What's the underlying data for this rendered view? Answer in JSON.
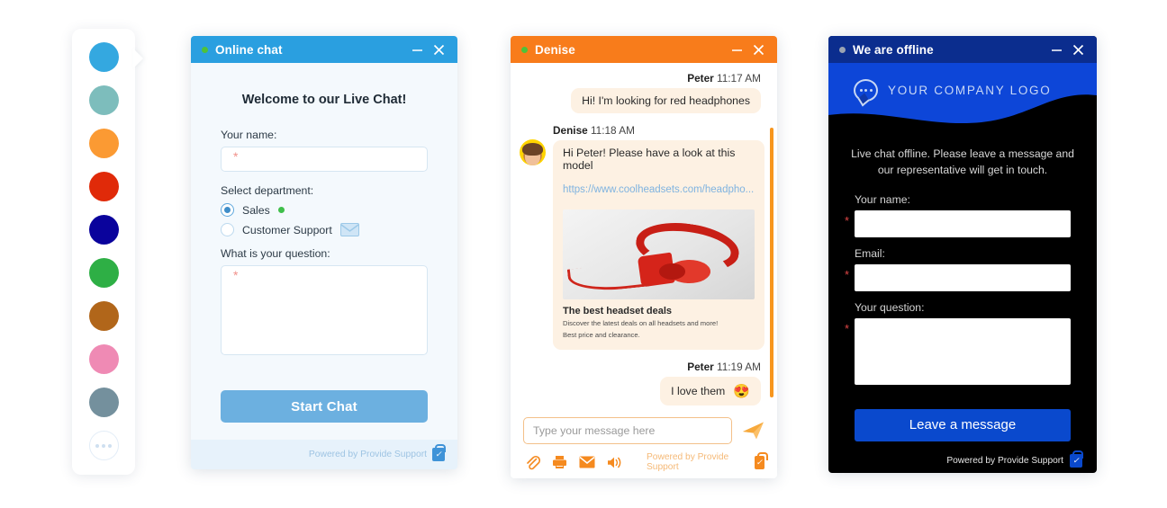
{
  "palette": {
    "name": "chat-theme-color-palette",
    "swatches": [
      {
        "name": "blue",
        "color": "#34a8e0"
      },
      {
        "name": "teal",
        "color": "#7dbdbc"
      },
      {
        "name": "orange",
        "color": "#fb9a33"
      },
      {
        "name": "red",
        "color": "#e02a09"
      },
      {
        "name": "navy",
        "color": "#0a039c"
      },
      {
        "name": "green",
        "color": "#2eaf45"
      },
      {
        "name": "brown",
        "color": "#b1661a"
      },
      {
        "name": "pink",
        "color": "#ef8ab4"
      },
      {
        "name": "slate-blue",
        "color": "#74909d"
      }
    ],
    "more_label": "more-colors"
  },
  "online_window": {
    "title": "Online chat",
    "status": "online",
    "status_color": "#4ec23a",
    "header_color": "#2a9fe0",
    "minimize_label": "Minimize",
    "close_label": "Close",
    "heading": "Welcome to our Live Chat!",
    "name_label": "Your name:",
    "name_value": "",
    "name_placeholder": "",
    "required_mark": "*",
    "department_label": "Select department:",
    "departments": [
      {
        "label": "Sales",
        "selected": true,
        "indicator": "online-dot"
      },
      {
        "label": "Customer Support",
        "selected": false,
        "indicator": "mail-icon"
      }
    ],
    "question_label": "What is your question:",
    "question_value": "",
    "question_placeholder": "",
    "start_button": "Start Chat",
    "powered_by": "Powered by Provide Support"
  },
  "denise_window": {
    "title": "Denise",
    "status": "online",
    "status_color": "#4ec23a",
    "header_color": "#f87c1b",
    "minimize_label": "Minimize",
    "close_label": "Close",
    "messages": [
      {
        "author": "Peter",
        "time": "11:17 AM",
        "side": "right",
        "text": "Hi! I'm looking for red headphones"
      },
      {
        "author": "Denise",
        "time": "11:18 AM",
        "side": "left",
        "text": "Hi Peter! Please have a look at this model",
        "link": "https://www.coolheadsets.com/headpho...",
        "card": {
          "image": "red-headphones-photo",
          "title": "The best headset deals",
          "line1": "Discover the latest deals on all headsets and more!",
          "line2": "Best price and clearance."
        }
      },
      {
        "author": "Peter",
        "time": "11:19 AM",
        "side": "right",
        "text": "I love them",
        "emoji": "😍"
      }
    ],
    "composer_placeholder": "Type your message here",
    "composer_value": "",
    "send_label": "Send",
    "tools": [
      "attachment-icon",
      "print-icon",
      "email-icon",
      "sound-icon"
    ],
    "powered_by": "Powered by Provide Support"
  },
  "offline_window": {
    "title": "We are offline",
    "status": "offline",
    "status_color": "#9aa3b2",
    "header_color": "#0b2d8e",
    "wave_color": "#0d46d8",
    "minimize_label": "Minimize",
    "close_label": "Close",
    "logo_text": "YOUR COMPANY LOGO",
    "offline_message": "Live chat offline. Please leave a message and our representative will get in touch.",
    "required_mark": "*",
    "fields": [
      {
        "label": "Your name:",
        "value": "",
        "type": "text"
      },
      {
        "label": "Email:",
        "value": "",
        "type": "text"
      },
      {
        "label": "Your question:",
        "value": "",
        "type": "textarea"
      }
    ],
    "submit_button": "Leave a message",
    "powered_by": "Powered by Provide Support"
  }
}
